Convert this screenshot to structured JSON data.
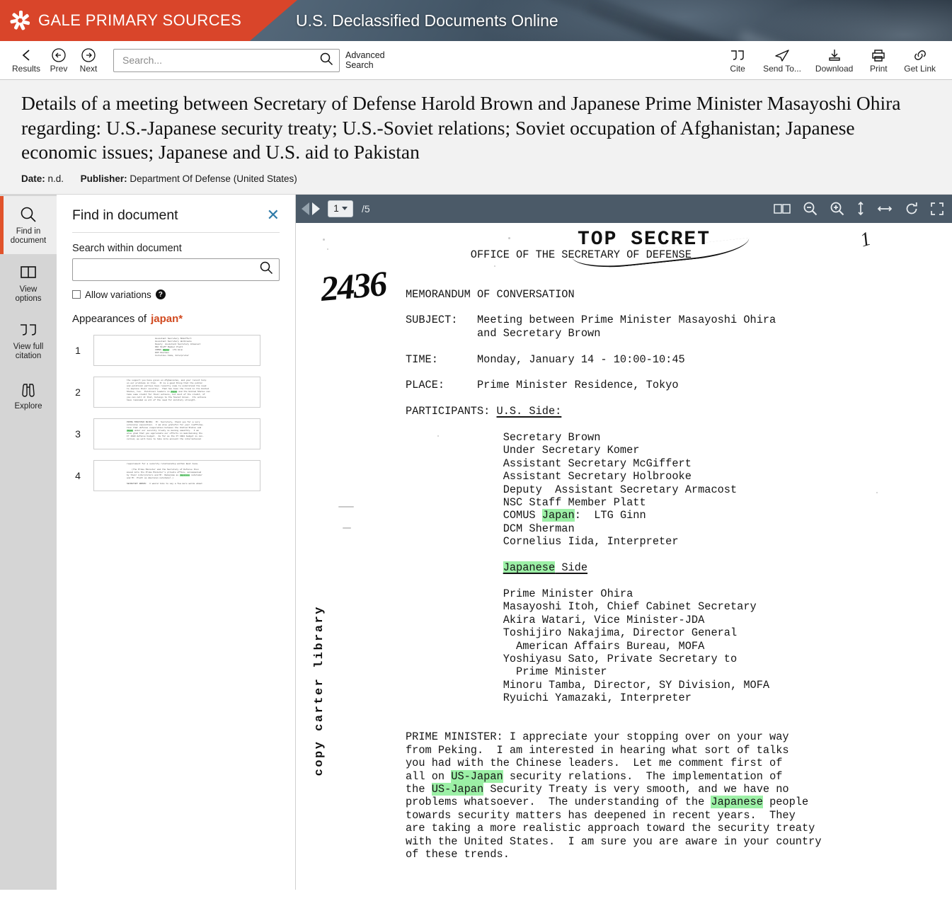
{
  "banner": {
    "brand": "GALE PRIMARY SOURCES",
    "product": "U.S. Declassified Documents Online",
    "brand_color": "#d9452a"
  },
  "toolbar": {
    "results_label": "Results",
    "prev_label": "Prev",
    "next_label": "Next",
    "search_placeholder": "Search...",
    "search_value": "",
    "advanced_search_line1": "Advanced",
    "advanced_search_line2": "Search",
    "cite_label": "Cite",
    "send_to_label": "Send To...",
    "download_label": "Download",
    "print_label": "Print",
    "get_link_label": "Get Link"
  },
  "document_meta": {
    "title": "Details of a meeting between Secretary of Defense Harold Brown and Japanese Prime Minister Masayoshi Ohira regarding: U.S.-Japanese security treaty; U.S.-Soviet relations; Soviet occupation of Afghanistan; Japanese economic issues; Japanese and U.S. aid to Pakistan",
    "date_label": "Date:",
    "date_value": "n.d.",
    "publisher_label": "Publisher:",
    "publisher_value": "Department Of Defense (United States)"
  },
  "rail": {
    "items": [
      {
        "label_line1": "Find in",
        "label_line2": "document",
        "icon": "search-icon",
        "active": true
      },
      {
        "label_line1": "View",
        "label_line2": "options",
        "icon": "columns-icon",
        "active": false
      },
      {
        "label_line1": "View full",
        "label_line2": "citation",
        "icon": "quote-icon",
        "active": false
      },
      {
        "label_line1": "Explore",
        "label_line2": "",
        "icon": "binoculars-icon",
        "active": false
      }
    ],
    "active_accent": "#e1532b"
  },
  "find_panel": {
    "title": "Find in document",
    "close_icon": "close-icon",
    "search_label": "Search within document",
    "search_placeholder": "",
    "search_value": "",
    "allow_variations_label": "Allow variations",
    "allow_variations_checked": false,
    "help_icon": "question-icon",
    "appearances_label": "Appearances of",
    "appearances_term": "japan*",
    "term_color": "#d1491f",
    "hits": [
      {
        "number": "1",
        "lines": [
          "Assistant Secretary McGiffert",
          "Assistant Secretary Holbrooke",
          "Deputy  Assistant Secretary Armacost",
          "NSC Staff Member Platt",
          "COMUS [[Japan]]:  LTG Ginn",
          "DCM Sherman",
          "Cornelius Iida, Interpreter"
        ]
      },
      {
        "number": "2",
        "lines": [
          "the support you have given on Afghanistan, and your recent help",
          "on our problems in Iran.  It is a good thing that the public",
          "and political parties have recently come to understand the need",
          "to improve their security.  That has been the trend in the United",
          "States, too.  Political leaders in [[Japan]] and the United States can",
          "take some credit for their actions, but most of the credit, if",
          "you can call it that, belongs to the Soviet Union.  Its actions",
          "have reminded us all of the need for military strength."
        ]
      },
      {
        "number": "3",
        "lines": [
          "PRIME MINISTER OHIRA:  Mr. Secretary, thank you for a very",
          "extensive exposition.  I am also grateful for your reaffirma-",
          "tion that defense cooperation between the United States and",
          "[[Japan]] under our security treaty is moving smoothly.  I am",
          "also glad that you appreciate our efforts in maintaining the",
          "FY 1980 defense budget.  As far as the FY 1981 budget is con-",
          "cerned, we will have to take into account the international"
        ]
      },
      {
        "number": "4",
        "lines": [
          "requirement for a security relationship within East Asia.",
          "",
          "    (The Prime Minister and the Secretary of Defense then",
          "moved into the Prime Minister's private office, accompanied",
          "by their interpreters and Mr. Nakajima as [[Japanese]] notetaker",
          "and Mr. Platt as American notetaker.)",
          "",
          "SECRETARY BROWN:  I would like to say a few more words about"
        ]
      }
    ],
    "highlight_color": "#9cf0a6"
  },
  "viewer": {
    "prev_page_icon": "triangle-left-icon",
    "next_page_icon": "triangle-right-icon",
    "current_page": "1",
    "total_pages": "/5",
    "tools": [
      {
        "icon": "two-page-view-icon"
      },
      {
        "icon": "zoom-out-icon"
      },
      {
        "icon": "zoom-in-icon"
      },
      {
        "icon": "fit-height-icon"
      },
      {
        "icon": "fit-width-icon"
      },
      {
        "icon": "rotate-icon"
      },
      {
        "icon": "fullscreen-icon"
      }
    ]
  },
  "page_image": {
    "hand_number": "2436",
    "hand_page_mark": "1",
    "stamp": "TOP SECRET",
    "side_note": "copy carter library",
    "heading": "OFFICE OF THE SECRETARY OF DEFENSE",
    "memo_title": "MEMORANDUM OF CONVERSATION",
    "subject_label": "SUBJECT:",
    "subject_line1": "Meeting between Prime Minister Masayoshi Ohira",
    "subject_line2": "and Secretary Brown",
    "time_label": "TIME:",
    "time_value": "Monday, January 14 - 10:00-10:45",
    "place_label": "PLACE:",
    "place_value": "Prime Minister Residence, Tokyo",
    "participants_label": "PARTICIPANTS:",
    "us_side_heading": "U.S. Side:",
    "us_side": [
      "Secretary Brown",
      "Under Secretary Komer",
      "Assistant Secretary McGiffert",
      "Assistant Secretary Holbrooke",
      "Deputy  Assistant Secretary Armacost",
      "NSC Staff Member Platt",
      "COMUS [[Japan]]:  LTG Ginn",
      "DCM Sherman",
      "Cornelius Iida, Interpreter"
    ],
    "japanese_side_heading": "[[Japanese]] Side",
    "japanese_side": [
      "Prime Minister Ohira",
      "Masayoshi Itoh, Chief Cabinet Secretary",
      "Akira Watari, Vice Minister-JDA",
      "Toshijiro Nakajima, Director General",
      "  American Affairs Bureau, MOFA",
      "Yoshiyasu Sato, Private Secretary to",
      "  Prime Minister",
      "Minoru Tamba, Director, SY Division, MOFA",
      "Ryuichi Yamazaki, Interpreter"
    ],
    "body_paragraph": [
      "PRIME MINISTER: I appreciate your stopping over on your way",
      "from Peking.  I am interested in hearing what sort of talks",
      "you had with the Chinese leaders.  Let me comment first of",
      "all on [[US-Japan]] security relations.  The implementation of",
      "the [[US-Japan]] Security Treaty is very smooth, and we have no",
      "problems whatsoever.  The understanding of the [[Japanese]] people",
      "towards security matters has deepened in recent years.  They",
      "are taking a more realistic approach toward the security treaty",
      "with the United States.  I am sure you are aware in your country",
      "of these trends."
    ]
  }
}
